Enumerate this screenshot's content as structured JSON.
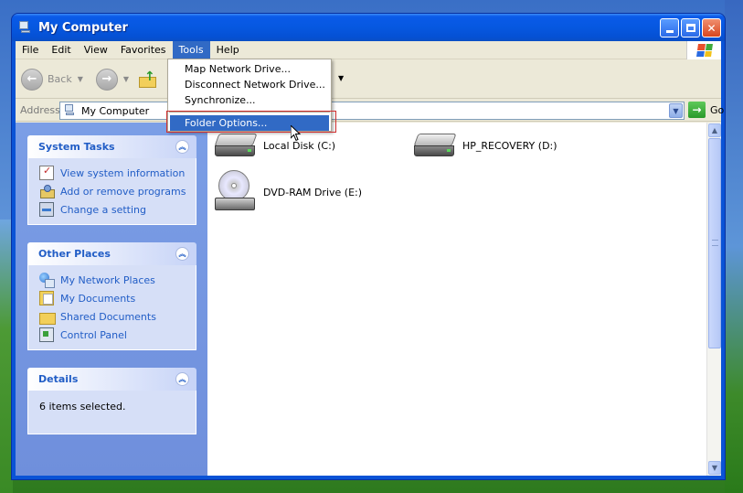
{
  "window": {
    "title": "My Computer"
  },
  "menubar": {
    "items": [
      {
        "label": "File"
      },
      {
        "label": "Edit"
      },
      {
        "label": "View"
      },
      {
        "label": "Favorites"
      },
      {
        "label": "Tools",
        "active": true
      },
      {
        "label": "Help"
      }
    ]
  },
  "toolbar": {
    "back_label": "Back"
  },
  "address": {
    "label": "Address",
    "value": "My Computer",
    "go_label": "Go"
  },
  "sidebar": {
    "system_tasks": {
      "title": "System Tasks",
      "items": [
        {
          "label": "View system information",
          "icon": "system-info-icon"
        },
        {
          "label": "Add or remove programs",
          "icon": "add-remove-icon"
        },
        {
          "label": "Change a setting",
          "icon": "control-panel-icon"
        }
      ]
    },
    "other_places": {
      "title": "Other Places",
      "items": [
        {
          "label": "My Network Places",
          "icon": "network-icon"
        },
        {
          "label": "My Documents",
          "icon": "documents-icon"
        },
        {
          "label": "Shared Documents",
          "icon": "folder-icon"
        },
        {
          "label": "Control Panel",
          "icon": "control-panel-icon"
        }
      ]
    },
    "details": {
      "title": "Details",
      "text": "6 items selected."
    }
  },
  "drives": [
    {
      "label": "Local Disk (C:)",
      "type": "hdd"
    },
    {
      "label": "HP_RECOVERY (D:)",
      "type": "hdd"
    },
    {
      "label": "DVD-RAM Drive (E:)",
      "type": "cdrom"
    }
  ],
  "tools_menu": {
    "items": [
      {
        "label": "Map Network Drive..."
      },
      {
        "label": "Disconnect Network Drive..."
      },
      {
        "label": "Synchronize..."
      },
      {
        "label": "Folder Options...",
        "highlighted": true
      }
    ]
  },
  "colors": {
    "selection": "#316ac5",
    "task_link": "#215dc6",
    "highlight_box": "#d03030"
  }
}
